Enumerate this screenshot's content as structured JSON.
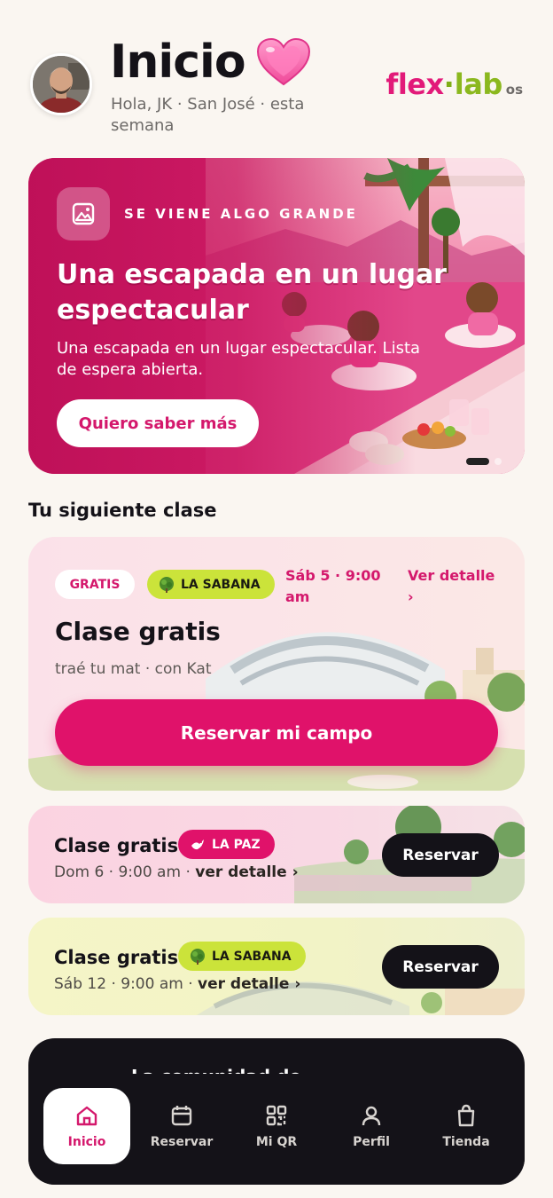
{
  "header": {
    "title": "Inicio",
    "greeting": "Hola, JK · San José · esta semana",
    "brand": {
      "part1": "flex",
      "dot": "·",
      "part2": "lab",
      "suffix": "os"
    }
  },
  "hero": {
    "eyebrow": "SE VIENE ALGO GRANDE",
    "title": "Una escapada en un lugar espectacular",
    "subtitle": "Una escapada en un lugar espectacular. Lista de espera abierta.",
    "cta": "Quiero saber más"
  },
  "section": {
    "title": "Tu siguiente clase"
  },
  "next_class": {
    "badge": "GRATIS",
    "location": "LA SABANA",
    "date": "Sáb 5 · 9:00 am",
    "detail_link": "Ver detalle ›",
    "title": "Clase gratis",
    "meta": "traé tu mat · con Kat",
    "cta": "Reservar mi campo"
  },
  "classes": [
    {
      "title": "Clase gratis",
      "location": "LA PAZ",
      "date": "Dom 6 · 9:00 am · ",
      "detail": "ver detalle ›",
      "cta": "Reservar"
    },
    {
      "title": "Clase gratis",
      "location": "LA SABANA",
      "date": "Sáb 12 · 9:00 am · ",
      "detail": "ver detalle ›",
      "cta": "Reservar"
    }
  ],
  "community": {
    "title": "La comunidad de"
  },
  "nav": {
    "items": [
      {
        "label": "Inicio",
        "icon": "home-icon"
      },
      {
        "label": "Reservar",
        "icon": "calendar-icon"
      },
      {
        "label": "Mi QR",
        "icon": "qr-icon"
      },
      {
        "label": "Perfil",
        "icon": "user-icon"
      },
      {
        "label": "Tienda",
        "icon": "bag-icon"
      }
    ]
  },
  "colors": {
    "accent": "#e0126a",
    "lime": "#cbe33a",
    "dark": "#141218",
    "background": "#faf6f1"
  }
}
